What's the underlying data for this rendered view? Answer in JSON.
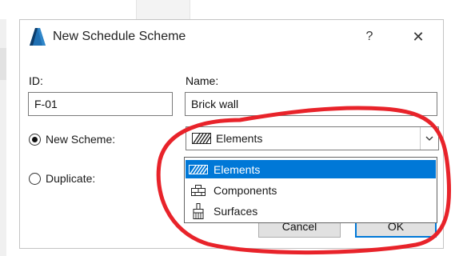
{
  "dialog": {
    "title": "New Schedule Scheme",
    "help_label": "?",
    "close_label": "✕"
  },
  "form": {
    "id_label": "ID:",
    "id_value": "F-01",
    "name_label": "Name:",
    "name_value": "Brick wall",
    "new_scheme_label": "New Scheme:",
    "duplicate_label": "Duplicate:",
    "selected_option": "New Scheme"
  },
  "scheme_select": {
    "value": "Elements",
    "icon": "hatch-pattern-icon"
  },
  "dropdown": {
    "items": [
      {
        "label": "Elements",
        "icon": "hatch-pattern-icon",
        "selected": true
      },
      {
        "label": "Components",
        "icon": "brick-structure-icon",
        "selected": false
      },
      {
        "label": "Surfaces",
        "icon": "paint-brush-icon",
        "selected": false
      }
    ]
  },
  "buttons": {
    "cancel_label": "Cancel",
    "ok_label": "OK"
  },
  "colors": {
    "accent": "#0078d7",
    "annotation": "#e8232a"
  }
}
